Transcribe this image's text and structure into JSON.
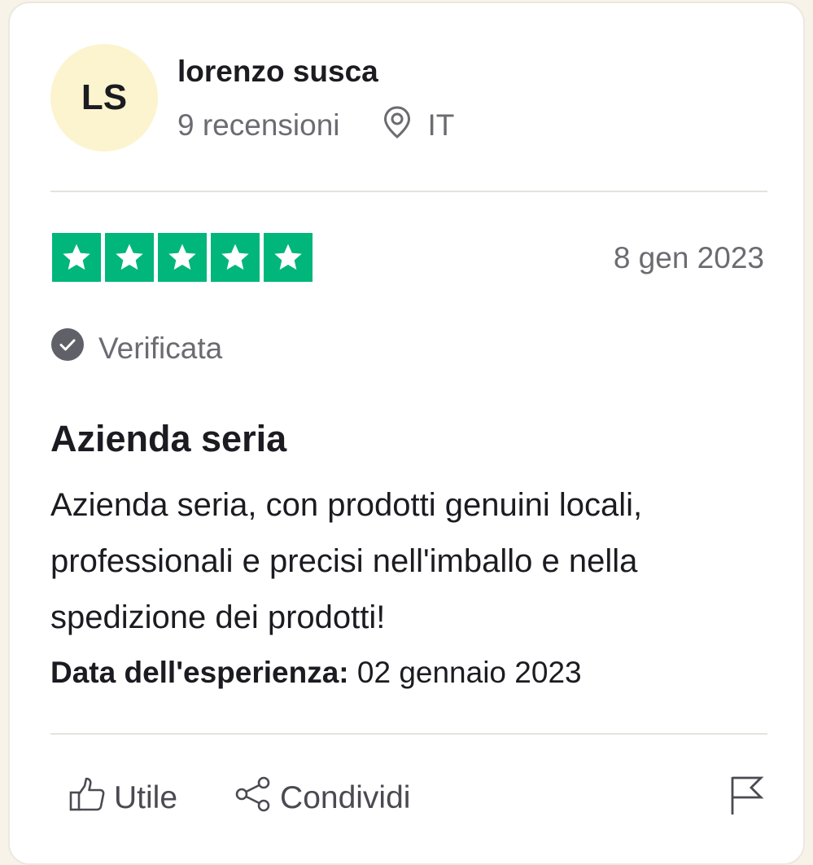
{
  "reviewer": {
    "initials": "LS",
    "name": "lorenzo susca",
    "reviews_count": "9 recensioni",
    "country": "IT",
    "avatar_color": "#fcf4cf"
  },
  "review": {
    "rating": 5,
    "max_rating": 5,
    "star_color": "#00b67a",
    "date": "8 gen 2023",
    "verified_label": "Verificata",
    "title": "Azienda seria",
    "body": "Azienda seria, con prodotti genuini locali, professionali e precisi nell'imballo e nella spedizione dei prodotti!",
    "experience_label": "Data dell'esperienza:",
    "experience_date": "02 gennaio 2023"
  },
  "actions": {
    "useful_label": "Utile",
    "share_label": "Condividi"
  },
  "icons": [
    "location-pin-icon",
    "star-icon",
    "check-circle-icon",
    "thumbs-up-icon",
    "share-icon",
    "flag-icon"
  ]
}
